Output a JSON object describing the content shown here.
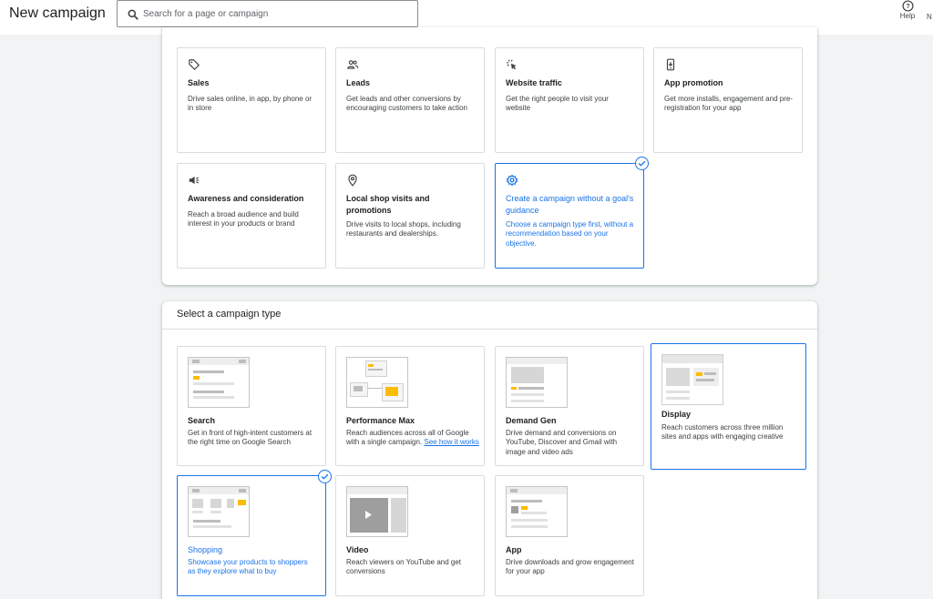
{
  "header": {
    "title": "New campaign",
    "search_placeholder": "Search for a page or campaign",
    "help_label": "Help",
    "next_label": "N"
  },
  "objectives": [
    {
      "title": "Sales",
      "description": "Drive sales online, in app, by phone or in store",
      "icon": "tag-icon",
      "selected": false
    },
    {
      "title": "Leads",
      "description": "Get leads and other conversions by encouraging customers to take action",
      "icon": "people-icon",
      "selected": false
    },
    {
      "title": "Website traffic",
      "description": "Get the right people to visit your website",
      "icon": "cursor-click-icon",
      "selected": false
    },
    {
      "title": "App promotion",
      "description": "Get more installs, engagement and pre-registration for your app",
      "icon": "phone-icon",
      "selected": false
    },
    {
      "title": "Awareness and consideration",
      "description": "Reach a broad audience and build interest in your products or brand",
      "icon": "megaphone-icon",
      "selected": false
    },
    {
      "title": "Local shop visits and promotions",
      "description": "Drive visits to local shops, including restaurants and dealerships.",
      "icon": "location-pin-icon",
      "selected": false
    },
    {
      "title": "Create a campaign without a goal's guidance",
      "description": "Choose a campaign type first, without a recommendation based on your objective.",
      "icon": "gear-icon",
      "selected": true
    }
  ],
  "campaign_type_section": {
    "title": "Select a campaign type"
  },
  "campaign_types": [
    {
      "title": "Search",
      "description": "Get in front of high-intent customers at the right time on Google Search",
      "selected": false
    },
    {
      "title": "Performance Max",
      "description": "Reach audiences across all of Google with a single campaign.",
      "link": "See how it works",
      "selected": false
    },
    {
      "title": "Demand Gen",
      "description": "Drive demand and conversions on YouTube, Discover and Gmail with image and video ads",
      "selected": false
    },
    {
      "title": "Display",
      "description": "Reach customers across three million sites and apps with engaging creative",
      "selected": false
    },
    {
      "title": "Shopping",
      "description": "Showcase your products to shoppers as they explore what to buy",
      "selected": true
    },
    {
      "title": "Video",
      "description": "Reach viewers on YouTube and get conversions",
      "selected": false
    },
    {
      "title": "App",
      "description": "Drive downloads and grow engagement for your app",
      "selected": false
    }
  ],
  "colors": {
    "accent": "#1a73e8",
    "highlight": "#fbbc04"
  }
}
